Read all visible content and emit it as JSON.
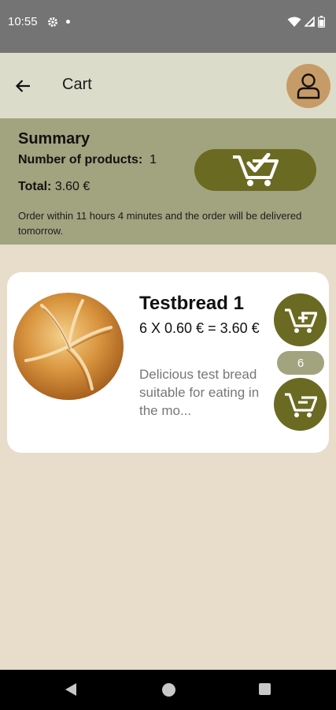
{
  "status_bar": {
    "time": "10:55",
    "icons": [
      "gear-icon",
      "dot-icon",
      "wifi-icon",
      "signal-icon",
      "battery-icon"
    ]
  },
  "app_bar": {
    "title": "Cart",
    "back_icon": "arrow-left-icon",
    "profile_icon": "person-icon"
  },
  "summary": {
    "title": "Summary",
    "count_label": "Number of products:",
    "count_value": "1",
    "total_label": "Total:",
    "total_value": "3.60 €",
    "note": "Order within 11 hours 4 minutes and the order will be delivered tomorrow.",
    "checkout_icon": "cart-check-icon"
  },
  "cart_items": [
    {
      "name": "Testbread 1",
      "price_line": "6 X 0.60 € = 3.60 €",
      "description": "Delicious test bread suitable for eating in the mo...",
      "quantity": "6",
      "image": "bread-roll-image",
      "add_icon": "cart-plus-icon",
      "remove_icon": "cart-minus-icon"
    }
  ],
  "colors": {
    "status_bar": "#747474",
    "app_bar": "#dcdccb",
    "summary_bg": "#a2a37f",
    "accent": "#6b6a22",
    "avatar": "#c79b67",
    "background": "#e8dccb",
    "card": "#ffffff"
  },
  "nav_bar": {
    "icons": [
      "nav-back-icon",
      "nav-home-icon",
      "nav-recents-icon"
    ]
  }
}
